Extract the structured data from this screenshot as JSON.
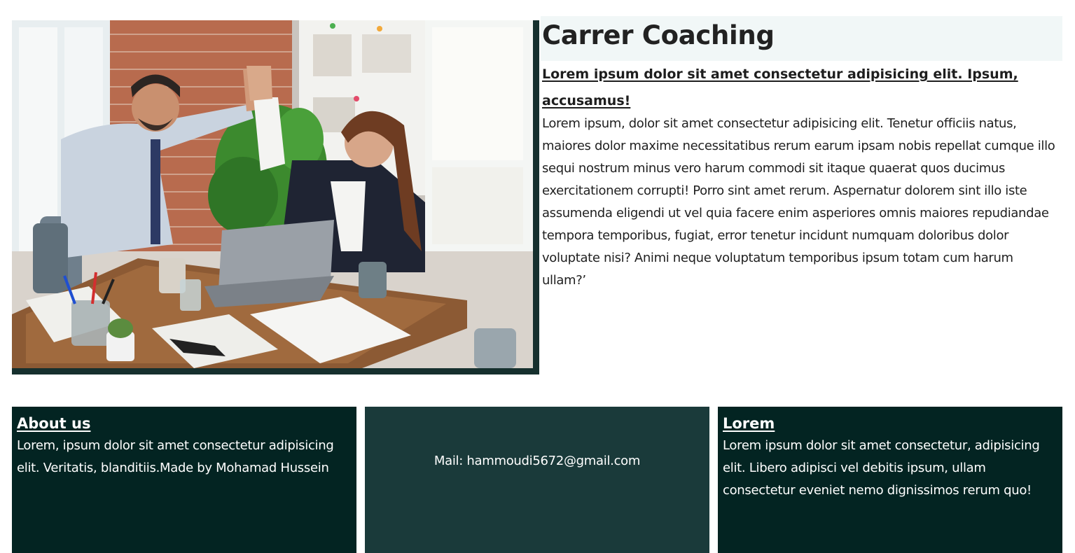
{
  "hero": {
    "image_alt": "Two colleagues giving a high five at an office desk"
  },
  "content": {
    "title": "Carrer Coaching",
    "subtitle": "Lorem ipsum dolor sit amet consectetur adipisicing elit. Ipsum, accusamus!",
    "body": "Lorem ipsum, dolor sit amet consectetur adipisicing elit. Tenetur officiis natus, maiores dolor maxime necessitatibus rerum earum ipsam nobis repellat cumque illo sequi nostrum minus vero harum commodi sit itaque quaerat quos ducimus exercitationem corrupti! Porro sint amet rerum. Aspernatur dolorem sint illo iste assumenda eligendi ut vel quia facere enim asperiores omnis maiores repudiandae tempora temporibus, fugiat, error tenetur incidunt numquam doloribus dolor voluptate nisi? Animi neque voluptatum temporibus ipsum totam cum harum ullam?’"
  },
  "footer": {
    "about": {
      "heading": "About us",
      "text": "Lorem, ipsum dolor sit amet consectetur adipisicing elit. Veritatis, blanditiis.Made by Mohamad Hussein"
    },
    "mail": {
      "text": "Mail: hammoudi5672@gmail.com"
    },
    "lorem": {
      "heading": "Lorem",
      "text": "Lorem ipsum dolor sit amet consectetur, adipisicing elit. Libero adipisci vel debitis ipsum, ullam consectetur eveniet nemo dignissimos rerum quo!"
    }
  },
  "colors": {
    "dark_teal": "#032422",
    "mid_teal": "#1a3a3a",
    "frame": "#16302e",
    "title_band": "#f1f7f7"
  }
}
